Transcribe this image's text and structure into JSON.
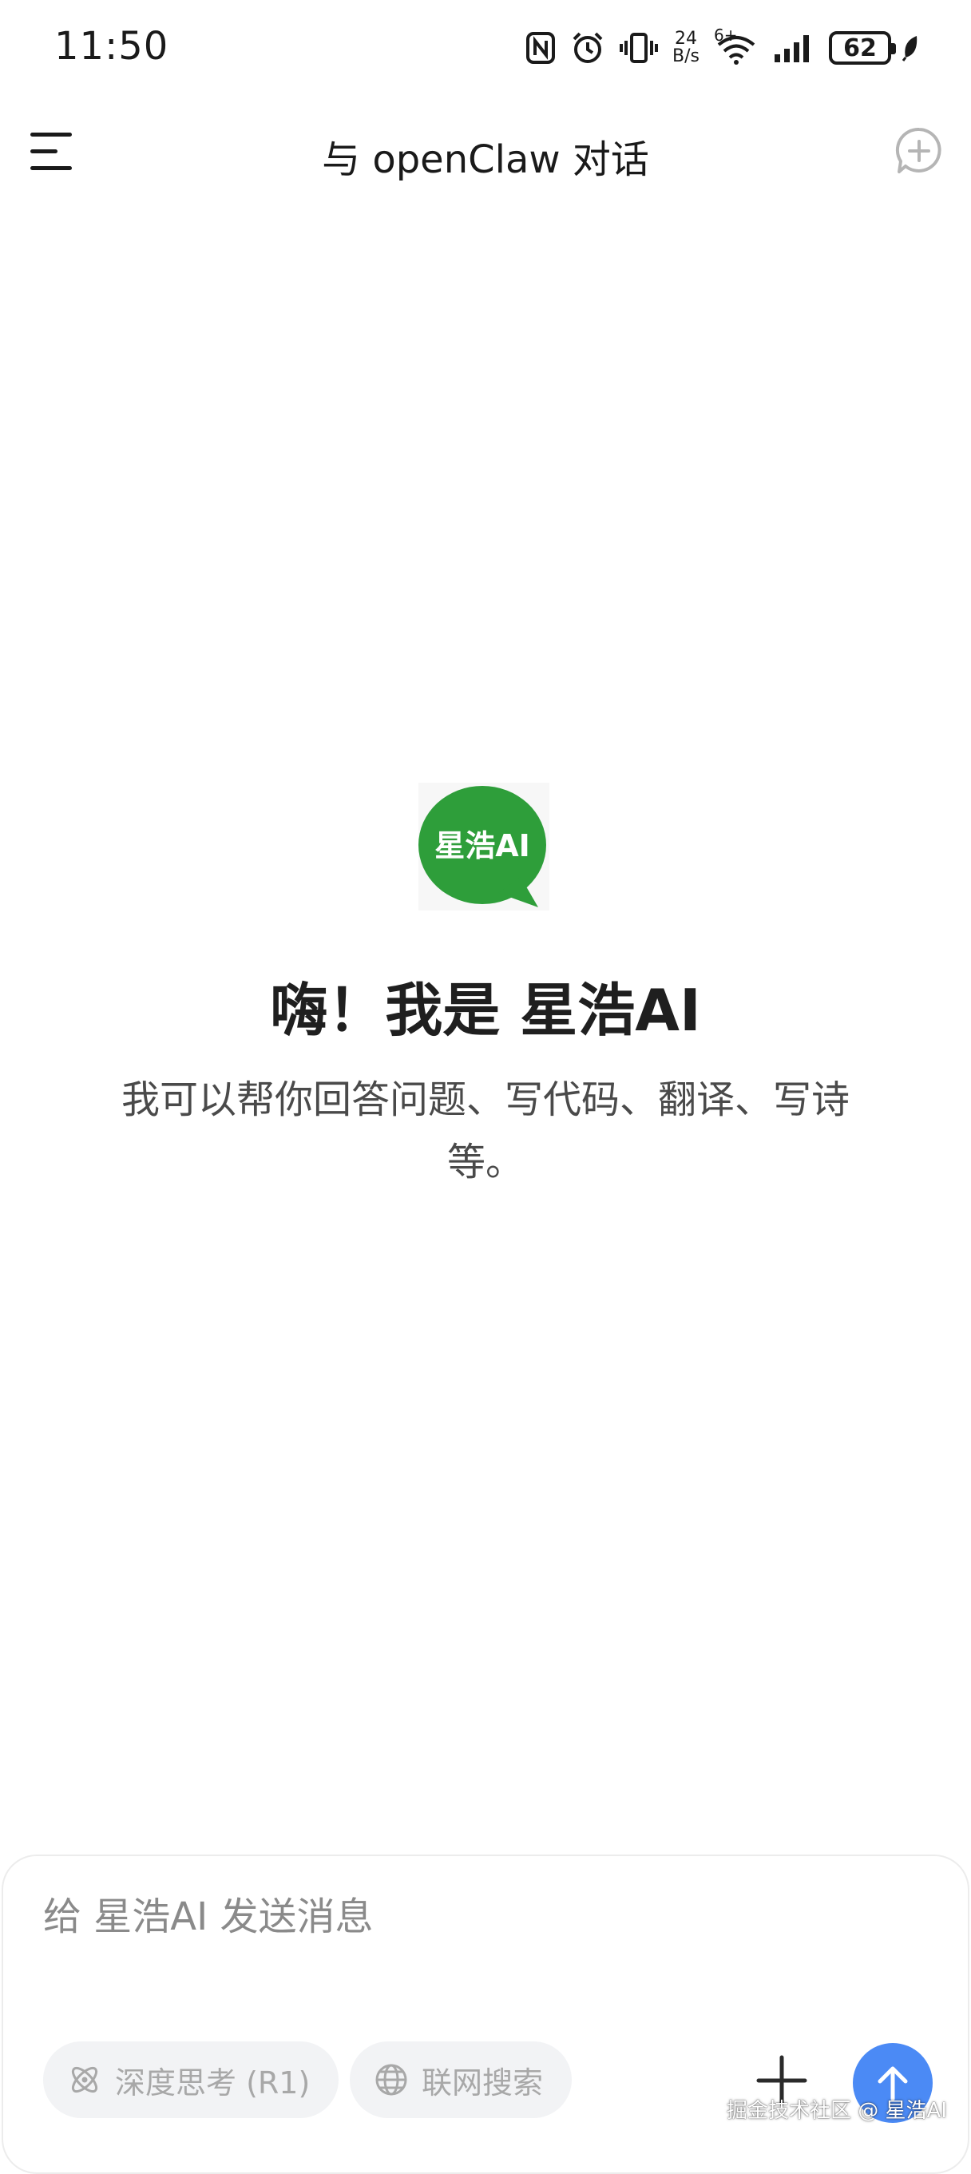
{
  "status_bar": {
    "time": "11:50",
    "net_speed_value": "24",
    "net_speed_unit": "B/s",
    "wifi_label": "6+",
    "battery_level": "62",
    "icons": [
      "nfc-icon",
      "alarm-icon",
      "vibrate-icon",
      "wifi-icon",
      "signal-icon",
      "battery-icon",
      "leaf-icon"
    ]
  },
  "header": {
    "title": "与 openClaw 对话",
    "menu_icon": "menu-icon",
    "new_chat_icon": "new-chat-icon"
  },
  "welcome": {
    "logo_text": "星浩AI",
    "title": "嗨！我是 星浩AI",
    "subtitle": "我可以帮你回答问题、写代码、翻译、写诗等。"
  },
  "composer": {
    "placeholder": "给 星浩AI 发送消息",
    "value": "",
    "deep_think_label": "深度思考 (R1)",
    "web_search_label": "联网搜索",
    "attach_icon": "plus-icon",
    "send_icon": "arrow-up-icon"
  },
  "watermark": "掘金技术社区 @ 星浩AI",
  "colors": {
    "accent": "#4b8af5",
    "logo_green": "#2e9e3a",
    "chip_bg": "#f2f3f5",
    "muted_text": "#a8a8a8"
  }
}
